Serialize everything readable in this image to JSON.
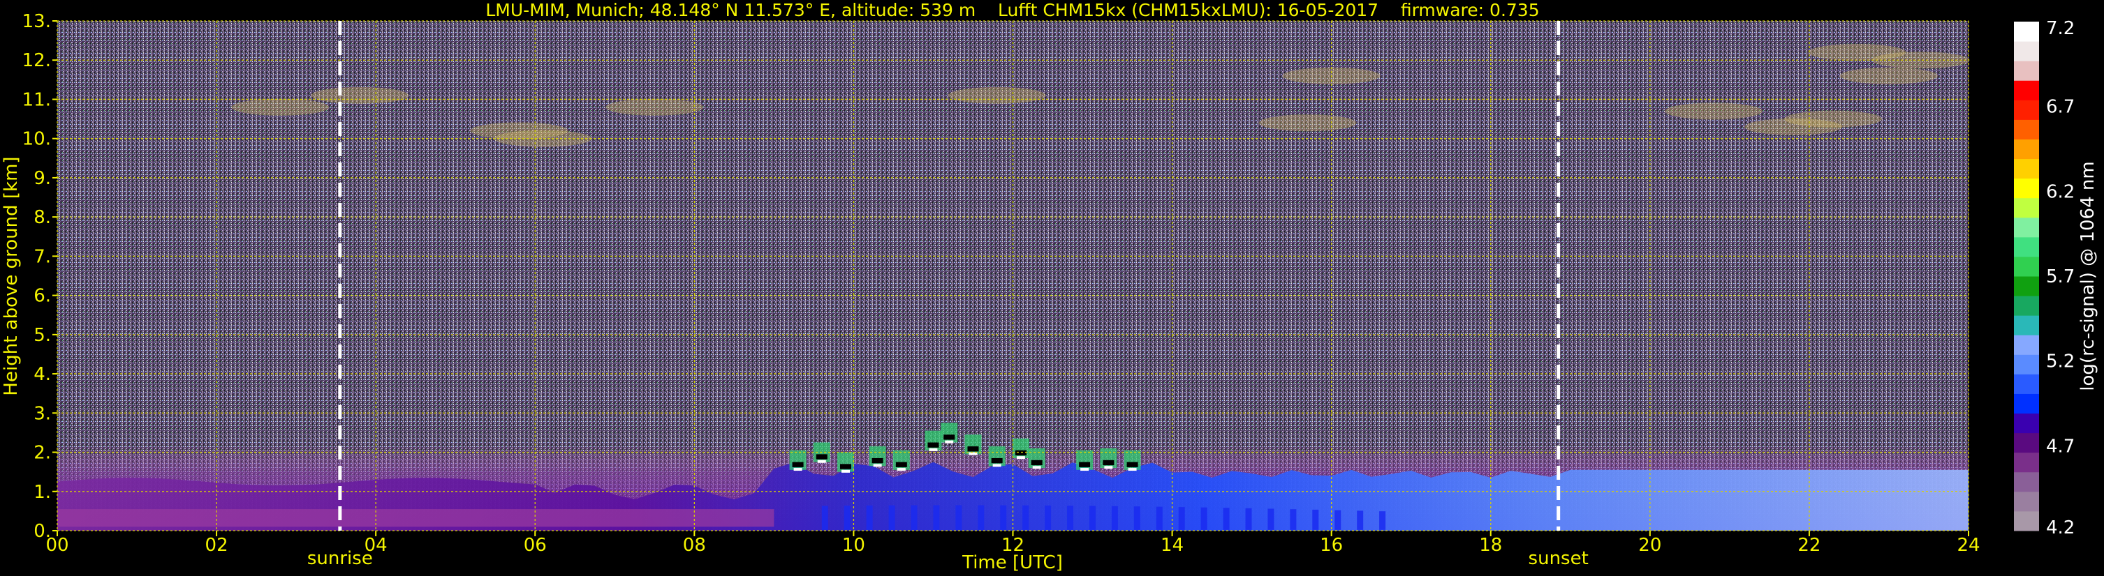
{
  "chart_data": {
    "type": "heatmap",
    "title": "LMU-MIM, Munich; 48.148° N 11.573° E, altitude: 539 m    Lufft CHM15kx (CHM15kxLMU): 16-05-2017    firmware: 0.735",
    "xlabel": "Time [UTC]",
    "ylabel": "Height above ground [km]",
    "xlim": [
      0,
      24
    ],
    "ylim": [
      0,
      13
    ],
    "x_ticks": [
      "00",
      "02",
      "04",
      "06",
      "08",
      "10",
      "12",
      "14",
      "16",
      "18",
      "20",
      "22",
      "24"
    ],
    "y_ticks": [
      "0.",
      "1.",
      "2.",
      "3.",
      "4.",
      "5.",
      "6.",
      "7.",
      "8.",
      "9.",
      "10.",
      "11.",
      "12.",
      "13."
    ],
    "grid": true,
    "markers": [
      {
        "label": "sunrise",
        "x": 3.55
      },
      {
        "label": "sunset",
        "x": 18.85
      }
    ],
    "colorbar": {
      "label": "log(rc-signal) @ 1064 nm",
      "range": [
        4.2,
        7.2
      ],
      "ticks": [
        "4.2",
        "4.7",
        "5.2",
        "5.7",
        "6.2",
        "6.7",
        "7.2"
      ],
      "colors": [
        "#a898a8",
        "#9a7fa0",
        "#8a5f98",
        "#7a2f8a",
        "#5a0a80",
        "#3a00b0",
        "#0030ff",
        "#2a5bff",
        "#5a8bff",
        "#86a8ff",
        "#2ab8b8",
        "#18a860",
        "#10a010",
        "#30d050",
        "#40e080",
        "#80f0a0",
        "#c0ff40",
        "#ffff00",
        "#ffd000",
        "#ffa000",
        "#ff6000",
        "#ff2000",
        "#ff0000",
        "#e8c0c0",
        "#f0e8e8",
        "#ffffff"
      ]
    },
    "features": [
      {
        "type": "boundary layer / aerosol",
        "x_range": [
          0,
          24
        ],
        "y_range": [
          0,
          1.8
        ]
      },
      {
        "type": "clouds",
        "x_range": [
          9.2,
          13.8
        ],
        "y_range": [
          1.2,
          2.9
        ]
      },
      {
        "type": "cirrus",
        "x_range": [
          2.5,
          8.0
        ],
        "y_range": [
          10.0,
          11.5
        ]
      },
      {
        "type": "cirrus",
        "x_range": [
          20.5,
          24
        ],
        "y_range": [
          10.0,
          12.5
        ]
      }
    ]
  }
}
